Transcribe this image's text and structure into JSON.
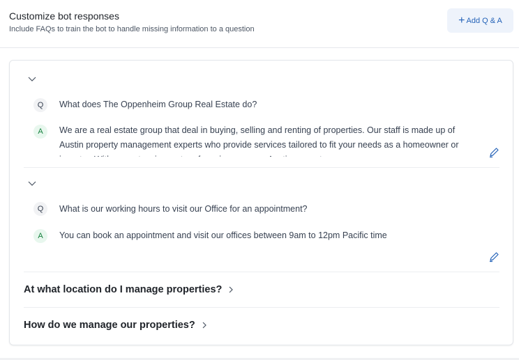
{
  "header": {
    "title": "Customize bot responses",
    "subtitle": "Include FAQs to train the bot to handle missing information to a question",
    "add_button_icon": "plus-icon",
    "add_button_label": "Add Q & A"
  },
  "colors": {
    "accent": "#2563b8",
    "accent_bg": "#eef3fb",
    "answer_badge_bg": "#e8f7ee",
    "answer_badge_text": "#15803d"
  },
  "qa_items": [
    {
      "expanded": true,
      "q_badge": "Q",
      "a_badge": "A",
      "question": "What does The Oppenheim Group Real Estate do?",
      "answer": "We are a real estate group that deal in buying, selling and renting of properties. Our staff is made up of Austin property management experts who provide services tailored to fit your needs as a homeowner or investor. With our extensive roster of services, we are Austin property"
    },
    {
      "expanded": true,
      "q_badge": "Q",
      "a_badge": "A",
      "question": "What is our working hours to visit our Office for an appointment?",
      "answer": "You can book an appointment and visit our offices between 9am to 12pm Pacific time"
    },
    {
      "expanded": false,
      "question": "At what location do I manage properties?"
    },
    {
      "expanded": false,
      "question": "How do we manage our properties?"
    }
  ]
}
